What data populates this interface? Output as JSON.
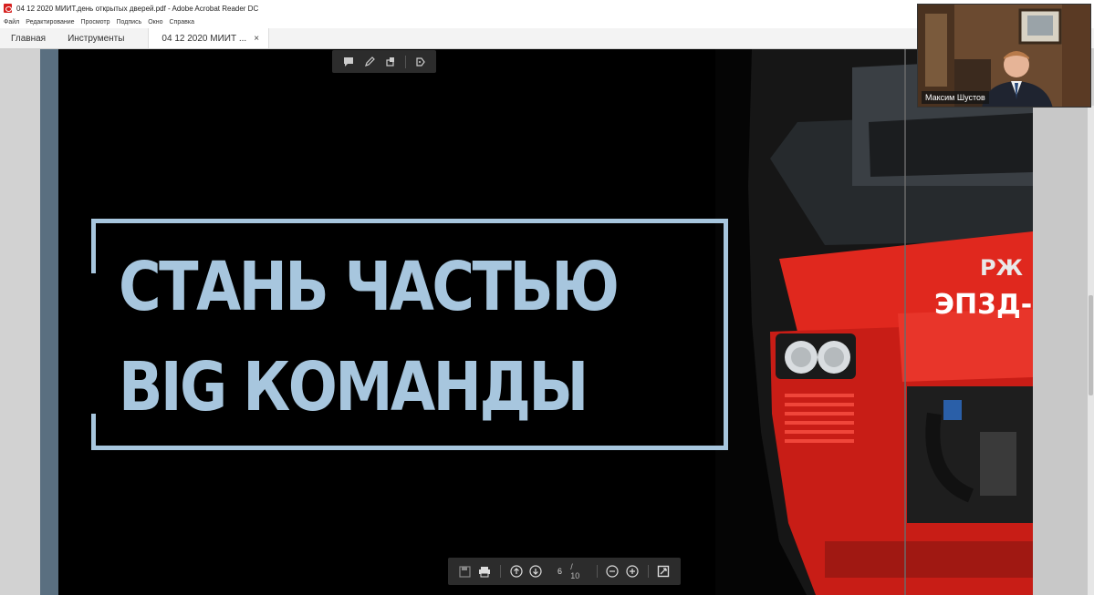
{
  "window": {
    "title": "04 12 2020 МИИТ.день открытых дверей.pdf - Adobe Acrobat Reader DC"
  },
  "menu": [
    "Файл",
    "Редактирование",
    "Просмотр",
    "Подпись",
    "Окно",
    "Справка"
  ],
  "tabs": {
    "home": "Главная",
    "tools": "Инструменты",
    "document": "04 12 2020 МИИТ ...",
    "close": "×"
  },
  "slide": {
    "line1": "СТАНЬ ЧАСТЬЮ",
    "line2": "BIG КОМАНДЫ",
    "train_text": "ЭП3Д-",
    "logo_text": "РЖ",
    "colors": {
      "background": "#000000",
      "headline": "#a7c6de",
      "train_red": "#e0281e"
    }
  },
  "toolbar_bottom": {
    "page": "6",
    "total": "/ 10"
  },
  "webcam": {
    "name": "Максим Шустов"
  },
  "icons": {
    "comment": "comment-icon",
    "pen": "pen-icon",
    "stamp": "stamp-icon",
    "share": "share-icon",
    "save": "save-icon",
    "print": "print-icon",
    "page_up": "arrow-up-circle-icon",
    "page_down": "arrow-down-circle-icon",
    "zoom_out": "zoom-out-icon",
    "zoom_in": "zoom-in-icon",
    "fit": "fit-page-icon"
  }
}
